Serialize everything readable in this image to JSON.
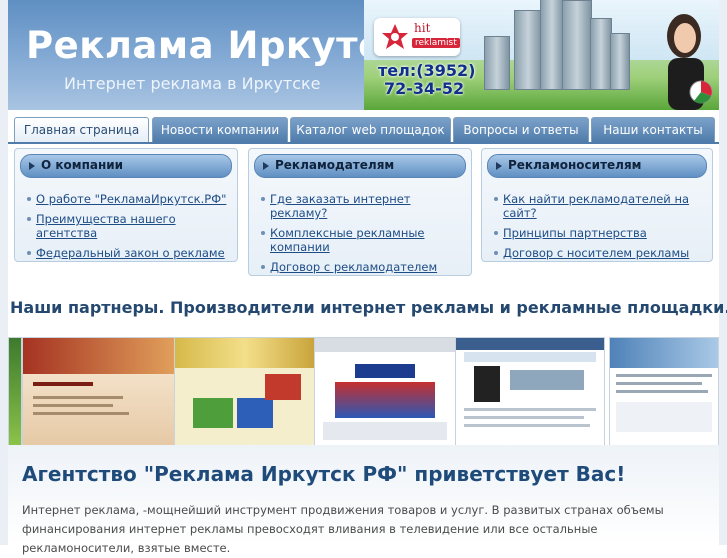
{
  "header": {
    "title": "Реклама Иркутск",
    "subtitle": "Интернет реклама в Иркутске",
    "banner": {
      "logo_hit": "hit",
      "logo_reklamist": "reklamist",
      "phone_line1": "тел:(3952)",
      "phone_line2": "72-34-52"
    }
  },
  "nav": {
    "tabs": [
      {
        "label": "Главная страница",
        "active": true
      },
      {
        "label": "Новости компании",
        "active": false
      },
      {
        "label": "Каталог web площадок",
        "active": false
      },
      {
        "label": "Вопросы и ответы",
        "active": false
      },
      {
        "label": "Наши контакты",
        "active": false
      }
    ]
  },
  "boxes": [
    {
      "title": "О компании",
      "links": [
        "О работе \"РекламаИркутск.РФ\"",
        "Преимущества нашего агентства",
        "Федеральный закон о рекламе"
      ]
    },
    {
      "title": "Рекламодателям",
      "links": [
        "Где заказать интернет рекламу?",
        "Комплексные рекламные компании",
        "Договор с рекламодателем"
      ]
    },
    {
      "title": "Рекламоносителям",
      "links": [
        "Как найти рекламодателей на сайт?",
        "Принципы партнерства",
        "Договор с носителем рекламы"
      ]
    }
  ],
  "partners": {
    "title": "Наши партнеры. Производители интернет рекламы и рекламные площадки."
  },
  "welcome": {
    "title": "Агентство \"Реклама Иркутск РФ\" приветствует Вас!",
    "text": "Интернет реклама, -мощнейший инструмент продвижения товаров и услуг. В развитых странах объемы финансирования интернет рекламы превосходят вливания в телевидение или все остальные рекламоносители, взятые вместе."
  },
  "colors": {
    "header_blue": "#5f8fc2",
    "nav_blue": "#4f7cab",
    "link": "#1e4d86",
    "heading": "#24486f"
  }
}
